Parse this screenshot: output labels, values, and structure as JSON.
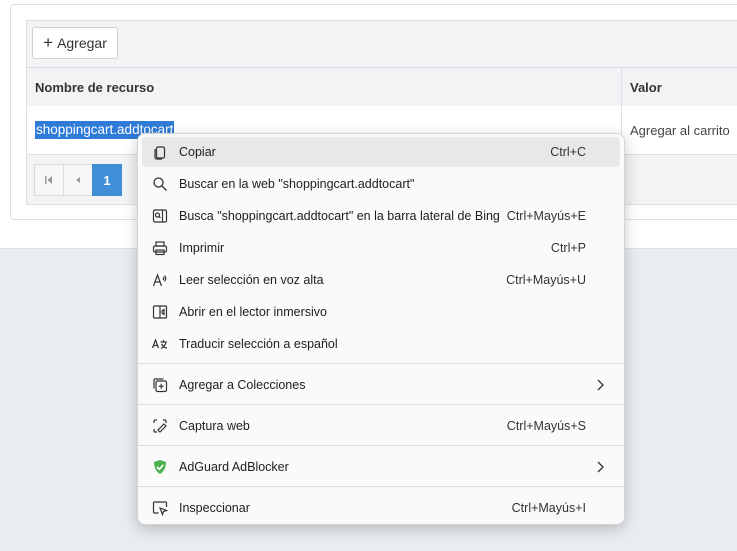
{
  "toolbar": {
    "add_label": "Agregar"
  },
  "table": {
    "headers": [
      "Nombre de recurso",
      "Valor"
    ],
    "row": {
      "name": "shoppingcart.addtocart",
      "value": "Agregar al carrito"
    }
  },
  "pager": {
    "current_page": "1"
  },
  "context_menu": {
    "items": [
      {
        "label": "Copiar",
        "shortcut": "Ctrl+C"
      },
      {
        "label": "Buscar en la web \"shoppingcart.addtocart\"",
        "shortcut": ""
      },
      {
        "label": "Busca \"shoppingcart.addtocart\" en la barra lateral de Bing",
        "shortcut": "Ctrl+Mayús+E"
      },
      {
        "label": "Imprimir",
        "shortcut": "Ctrl+P"
      },
      {
        "label": "Leer selección en voz alta",
        "shortcut": "Ctrl+Mayús+U"
      },
      {
        "label": "Abrir en el lector inmersivo",
        "shortcut": ""
      },
      {
        "label": "Traducir selección a español",
        "shortcut": ""
      },
      {
        "label": "Agregar a Colecciones",
        "shortcut": ""
      },
      {
        "label": "Captura web",
        "shortcut": "Ctrl+Mayús+S"
      },
      {
        "label": "AdGuard AdBlocker",
        "shortcut": ""
      },
      {
        "label": "Inspeccionar",
        "shortcut": "Ctrl+Mayús+I"
      }
    ],
    "icons": [
      "copy-icon",
      "search-icon",
      "bing-sidebar-icon",
      "print-icon",
      "read-aloud-icon",
      "immersive-reader-icon",
      "translate-icon",
      "collections-icon",
      "web-capture-icon",
      "adguard-shield-icon",
      "inspect-icon"
    ],
    "accent_color": "#4caf50"
  },
  "colors": {
    "selection": "#2f7bd8",
    "pager_active": "#3f8ed6"
  }
}
